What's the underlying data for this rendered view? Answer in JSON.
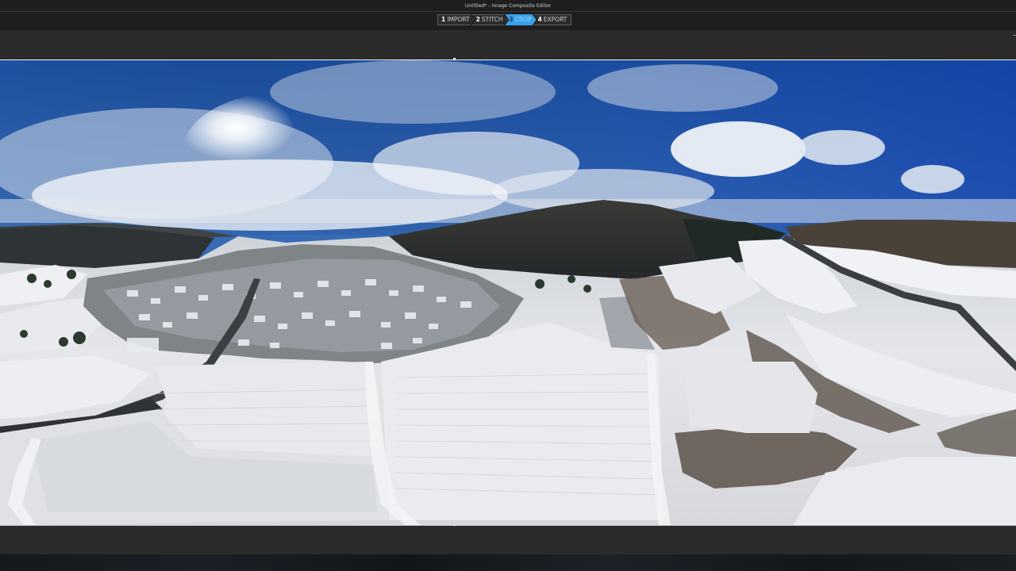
{
  "window": {
    "title": "Untitled* - Image Composite Editor"
  },
  "workflow": {
    "steps": [
      {
        "number": "1",
        "label": "IMPORT"
      },
      {
        "number": "2",
        "label": "STITCH"
      },
      {
        "number": "3",
        "label": "CROP"
      },
      {
        "number": "4",
        "label": "EXPORT"
      }
    ],
    "active_step": "CROP"
  },
  "colors": {
    "active_step": "#3aa0e8",
    "background": "#2b2b2b",
    "titlebar": "#1e1e1e"
  },
  "icons": {
    "crop_handle": "square-handle"
  }
}
